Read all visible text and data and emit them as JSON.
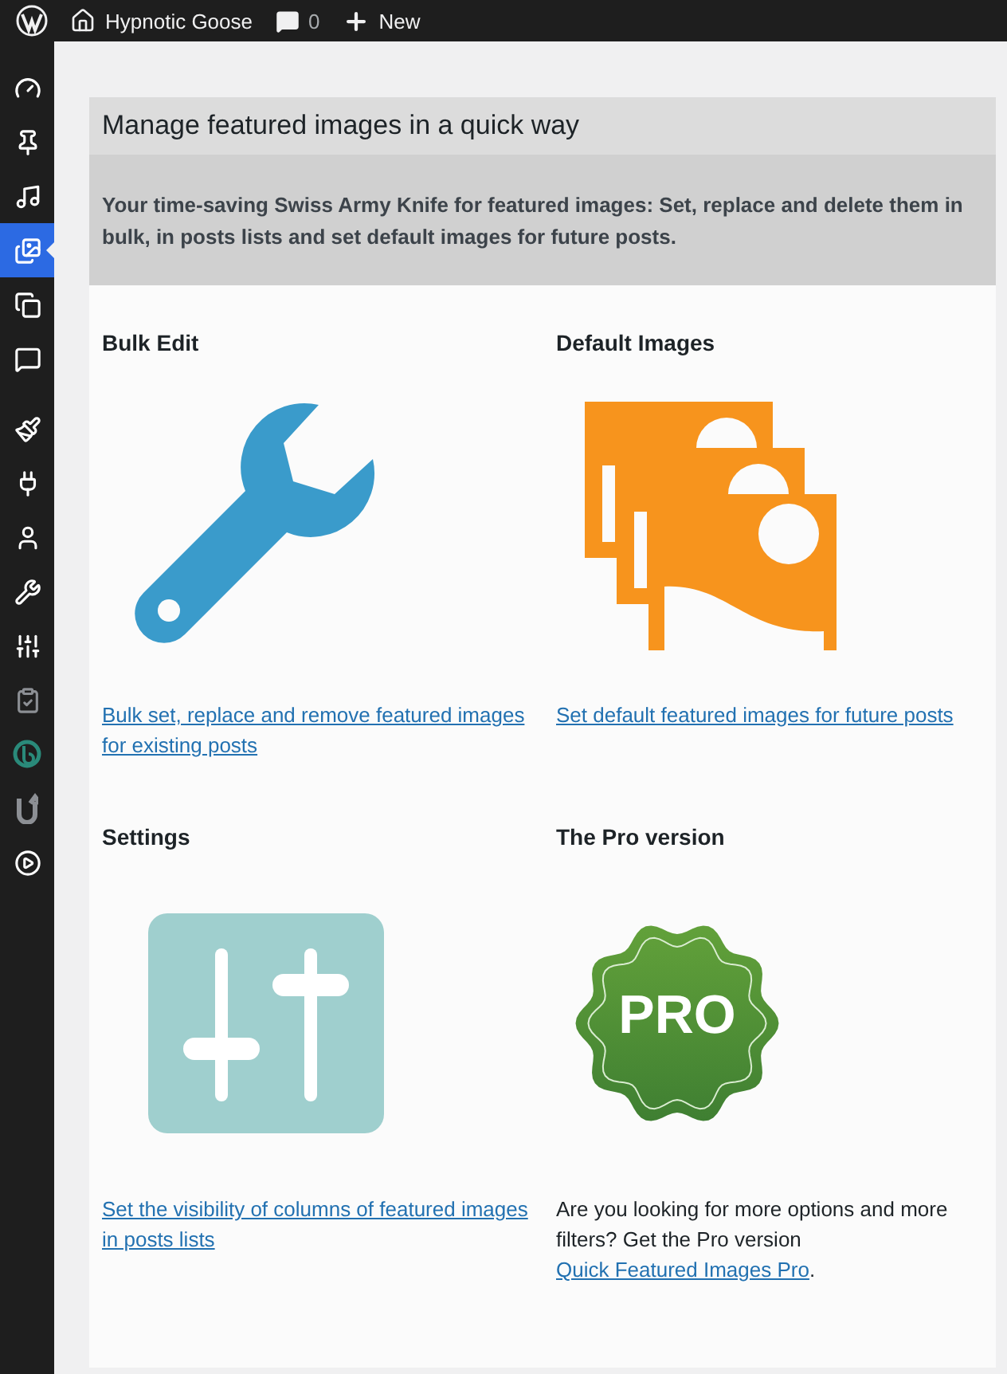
{
  "top_bar": {
    "site_name": "Hypnotic Goose",
    "comments": "0",
    "new_label": "New"
  },
  "sidebar": {
    "items": [
      {
        "selected": false
      },
      {
        "selected": false
      },
      {
        "selected": false
      },
      {
        "selected": true
      },
      {
        "selected": false
      },
      {
        "selected": false
      },
      {
        "selected": false
      },
      {
        "selected": false
      },
      {
        "selected": false
      },
      {
        "selected": false
      },
      {
        "selected": false
      },
      {
        "selected": false
      },
      {
        "selected": false
      },
      {
        "selected": false
      },
      {
        "selected": false
      }
    ]
  },
  "panel": {
    "title": "Manage featured images in a quick way",
    "intro": "Your time-saving Swiss Army Knife for featured images: Set, replace and delete them in bulk, in posts lists and set default images for future posts."
  },
  "sections": [
    {
      "kind": "wrench",
      "heading": "Bulk Edit",
      "link": "Bulk set, replace and remove featured images for existing posts"
    },
    {
      "kind": "images",
      "heading": "Default Images",
      "link": "Set default featured images for future posts"
    },
    {
      "kind": "sliders",
      "heading": "Settings",
      "link": "Set the visibility of columns of featured images in posts lists"
    },
    {
      "kind": "pro",
      "heading": "The Pro version",
      "badge": "PRO",
      "text": "Are you looking for more options and more filters? Get the Pro version ",
      "link": "Quick Featured Images Pro",
      "after": "."
    }
  ]
}
